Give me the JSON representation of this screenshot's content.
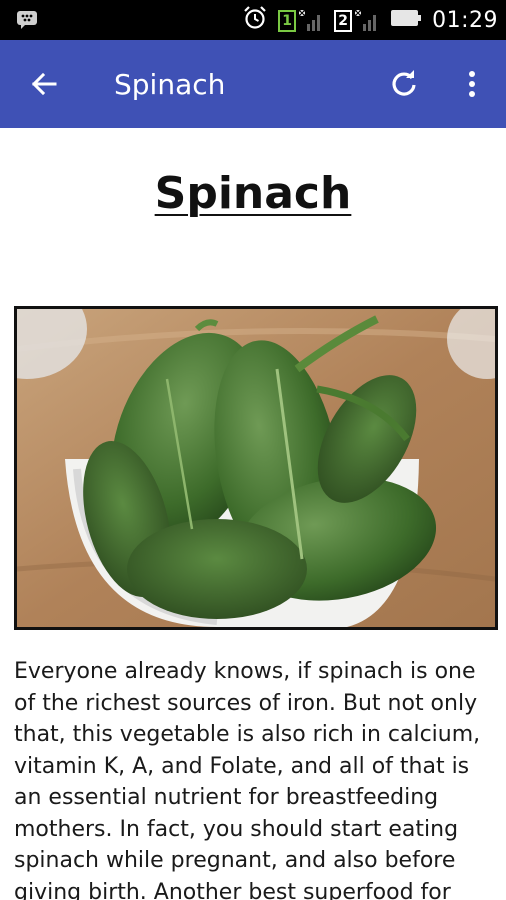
{
  "status_bar": {
    "time": "01:29",
    "sim1_label": "1",
    "sim2_label": "2",
    "icons": [
      "bbm-icon",
      "alarm-icon",
      "sim1-signal-icon",
      "sim2-signal-icon",
      "battery-icon"
    ]
  },
  "app_bar": {
    "title": "Spinach",
    "icons": [
      "back-arrow-icon",
      "refresh-icon",
      "overflow-menu-icon"
    ]
  },
  "article": {
    "title": "Spinach",
    "image_subject": "spinach-leaves-in-white-bowl",
    "body": "Everyone already knows, if spinach is one of the richest sources of iron. But not only that, this vegetable is also rich in calcium, vitamin K, A, and Folate, and all of that is an essential nutrient for breastfeeding mothers. In fact, you should start eating spinach while pregnant, and also before giving birth. Another best superfood for"
  },
  "colors": {
    "app_bar": "#3f51b5",
    "status_bar": "#000000",
    "text": "#1a1a1a"
  }
}
